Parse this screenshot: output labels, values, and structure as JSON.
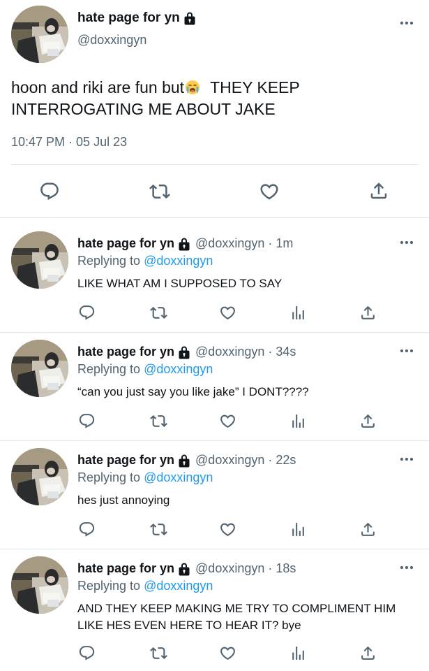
{
  "main_tweet": {
    "author_name": "hate page for yn",
    "handle": "@doxxingyn",
    "text_before_emoji": "hoon and riki are fun but",
    "text_after_emoji": "THEY KEEP INTERROGATING ME ABOUT JAKE",
    "emoji_icon": "loudly-crying-face-icon",
    "timestamp": "10:47 PM · 05 Jul 23",
    "actions": [
      "reply-icon",
      "retweet-icon",
      "like-icon",
      "share-icon"
    ]
  },
  "replies": [
    {
      "author_name": "hate page for yn",
      "handle": "@doxxingyn · 1m",
      "replying_prefix": "Replying to",
      "replying_mention": "@doxxingyn",
      "text": "LIKE WHAT AM I SUPPOSED TO SAY"
    },
    {
      "author_name": "hate page for yn",
      "handle": "@doxxingyn · 34s",
      "replying_prefix": "Replying to",
      "replying_mention": "@doxxingyn",
      "text": "“can you just say you like jake” I DONT????"
    },
    {
      "author_name": "hate page for yn",
      "handle": "@doxxingyn · 22s",
      "replying_prefix": "Replying to",
      "replying_mention": "@doxxingyn",
      "text": "hes just annoying"
    },
    {
      "author_name": "hate page for yn",
      "handle": "@doxxingyn · 18s",
      "replying_prefix": "Replying to",
      "replying_mention": "@doxxingyn",
      "text": "AND THEY KEEP MAKING ME TRY TO COMPLIMENT HIM LIKE HES EVEN HERE TO HEAR IT? bye"
    }
  ],
  "colors": {
    "text": "#0f1419",
    "secondary": "#536471",
    "mention": "#1d9bf0",
    "divider": "#e1e6ea"
  }
}
